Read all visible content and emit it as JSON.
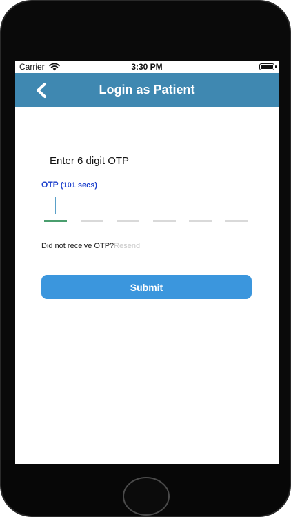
{
  "status_bar": {
    "carrier": "Carrier",
    "time": "3:30 PM"
  },
  "nav": {
    "title": "Login as Patient",
    "back_icon": "chevron-left-icon",
    "color": "#3f88b1"
  },
  "otp": {
    "heading": "Enter 6 digit OTP",
    "label": "OTP",
    "timer": "(101 secs)",
    "digit_count": 6,
    "active_color": "#4a9e6e",
    "inactive_color": "#d9d9d9"
  },
  "resend": {
    "prompt": "Did not receive OTP?",
    "link": "Resend"
  },
  "submit": {
    "label": "Submit",
    "color": "#3b96dd"
  }
}
